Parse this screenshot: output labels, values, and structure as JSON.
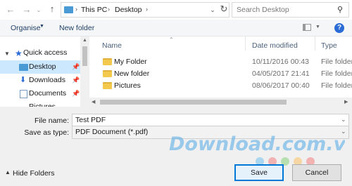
{
  "address_bar": {
    "crumbs": [
      "This PC",
      "Desktop"
    ],
    "search_placeholder": "Search Desktop"
  },
  "toolbar": {
    "organise_label": "Organise",
    "new_folder_label": "New folder",
    "help_label": "?"
  },
  "nav": {
    "items": [
      {
        "label": "Quick access"
      },
      {
        "label": "Desktop"
      },
      {
        "label": "Downloads"
      },
      {
        "label": "Documents"
      },
      {
        "label": "Pictures"
      }
    ]
  },
  "file_list": {
    "columns": [
      "Name",
      "Date modified",
      "Type"
    ],
    "rows": [
      {
        "name": "My Folder",
        "date": "10/11/2016 00:43",
        "type": "File folder"
      },
      {
        "name": "New folder",
        "date": "04/05/2017 21:41",
        "type": "File folder"
      },
      {
        "name": "Pictures",
        "date": "08/06/2017 00:40",
        "type": "File folder"
      }
    ]
  },
  "save_form": {
    "file_name_label": "File name:",
    "file_name_value": "Test PDF",
    "save_type_label": "Save as type:",
    "save_type_value": "PDF Document (*.pdf)"
  },
  "footer": {
    "hide_folders_label": "Hide Folders",
    "save_label": "Save",
    "cancel_label": "Cancel"
  },
  "watermark": {
    "text": "Download.com.vn"
  },
  "colors": {
    "accent": "#0078d7",
    "selection": "#cce8ff",
    "folder": "#f2c94c"
  }
}
